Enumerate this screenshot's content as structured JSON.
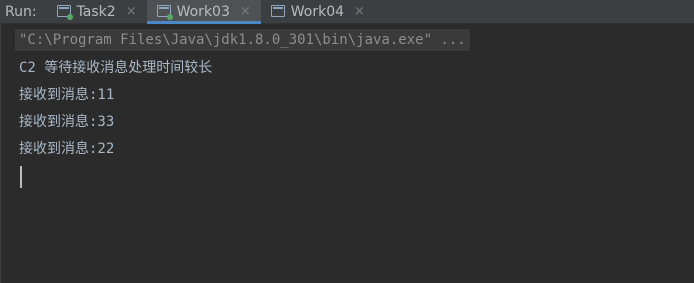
{
  "run_label": "Run:",
  "tabs": [
    {
      "label": "Task2",
      "icon": "console-icon",
      "running": true,
      "active": false
    },
    {
      "label": "Work03",
      "icon": "console-icon",
      "running": true,
      "active": true
    },
    {
      "label": "Work04",
      "icon": "console-icon",
      "running": false,
      "active": false
    }
  ],
  "close_glyph": "×",
  "console": {
    "command": "\"C:\\Program Files\\Java\\jdk1.8.0_301\\bin\\java.exe\" ...",
    "lines": [
      "C2 等待接收消息处理时间较长",
      "接收到消息:11",
      "接收到消息:33",
      "接收到消息:22"
    ]
  },
  "colors": {
    "background": "#2b2b2b",
    "toolbar": "#3c3f41",
    "active_tab_underline": "#4a88c7",
    "text": "#a9b7c6",
    "running_dot": "#59a869"
  }
}
